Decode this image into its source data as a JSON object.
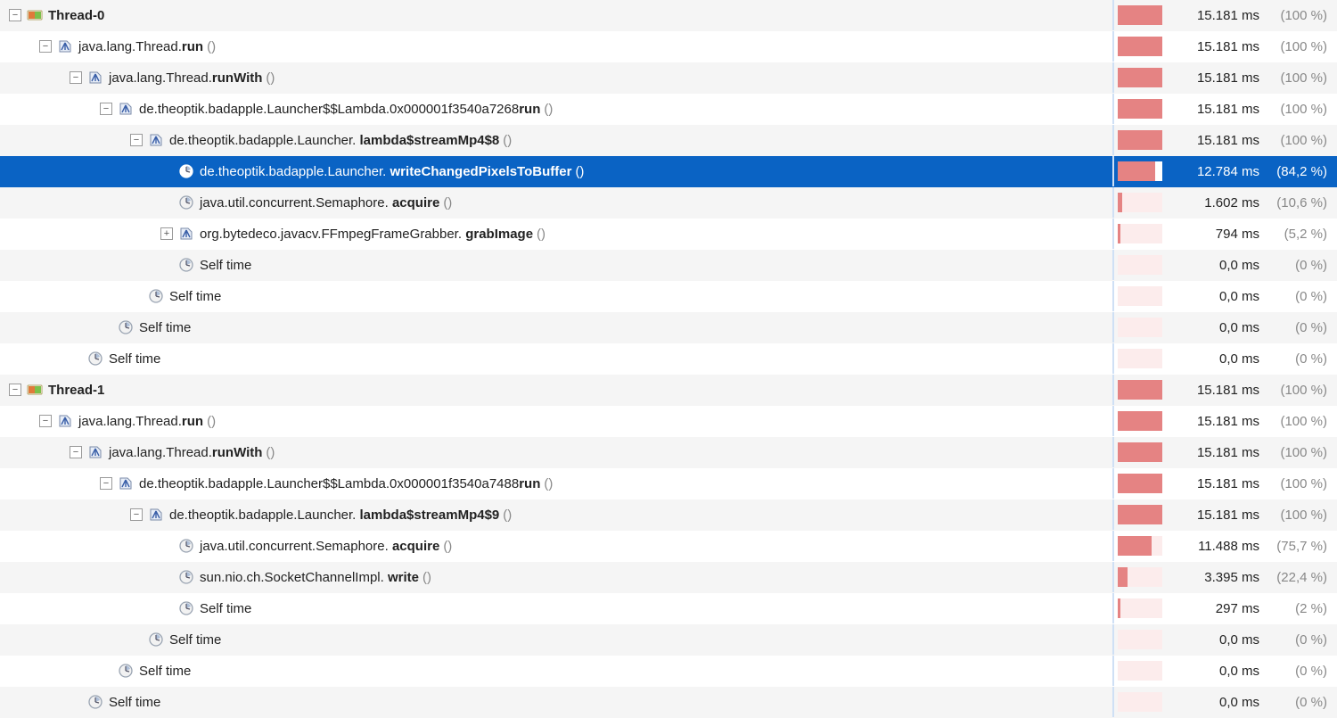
{
  "maxTime": 15.181,
  "rows": [
    {
      "depth": 0,
      "toggle": "minus",
      "icon": "thread",
      "pre": "",
      "bold": "Thread-0",
      "post": "",
      "paren": "",
      "time": 15.181,
      "timeLabel": "15.181 ms",
      "pct": "(100 %)",
      "alt": true,
      "selected": false
    },
    {
      "depth": 1,
      "toggle": "minus",
      "icon": "method",
      "pre": "java.lang.Thread.",
      "bold": "run",
      "post": "",
      "paren": "()",
      "time": 15.181,
      "timeLabel": "15.181 ms",
      "pct": "(100 %)",
      "alt": false,
      "selected": false
    },
    {
      "depth": 2,
      "toggle": "minus",
      "icon": "method",
      "pre": "java.lang.Thread.",
      "bold": "runWith",
      "post": "",
      "paren": "()",
      "time": 15.181,
      "timeLabel": "15.181 ms",
      "pct": "(100 %)",
      "alt": true,
      "selected": false
    },
    {
      "depth": 3,
      "toggle": "minus",
      "icon": "method",
      "pre": "de.theoptik.badapple.Launcher$$Lambda.0x000001f3540a7268",
      "bold": "run",
      "post": "",
      "paren": "()",
      "time": 15.181,
      "timeLabel": "15.181 ms",
      "pct": "(100 %)",
      "alt": false,
      "selected": false
    },
    {
      "depth": 4,
      "toggle": "minus",
      "icon": "method",
      "pre": "de.theoptik.badapple.Launcher. ",
      "bold": "lambda$streamMp4$8",
      "post": "",
      "paren": "()",
      "time": 15.181,
      "timeLabel": "15.181 ms",
      "pct": "(100 %)",
      "alt": true,
      "selected": false
    },
    {
      "depth": 5,
      "toggle": "leaf",
      "icon": "clock",
      "pre": "de.theoptik.badapple.Launcher. ",
      "bold": "writeChangedPixelsToBuffer",
      "post": "",
      "paren": "()",
      "time": 12.784,
      "timeLabel": "12.784 ms",
      "pct": "(84,2 %)",
      "alt": false,
      "selected": true
    },
    {
      "depth": 5,
      "toggle": "leaf",
      "icon": "clock",
      "pre": "java.util.concurrent.Semaphore. ",
      "bold": "acquire",
      "post": "",
      "paren": "()",
      "time": 1.602,
      "timeLabel": "1.602 ms",
      "pct": "(10,6 %)",
      "alt": true,
      "selected": false
    },
    {
      "depth": 5,
      "toggle": "plus",
      "icon": "method",
      "pre": "org.bytedeco.javacv.FFmpegFrameGrabber. ",
      "bold": "grabImage",
      "post": "",
      "paren": "()",
      "time": 0.794,
      "timeLabel": "794 ms",
      "pct": "(5,2 %)",
      "alt": false,
      "selected": false
    },
    {
      "depth": 5,
      "toggle": "leaf",
      "icon": "clock",
      "pre": "Self time",
      "bold": "",
      "post": "",
      "paren": "",
      "time": 0,
      "timeLabel": "0,0 ms",
      "pct": "(0 %)",
      "alt": true,
      "selected": false
    },
    {
      "depth": 4,
      "toggle": "leaf",
      "icon": "clock",
      "pre": "Self time",
      "bold": "",
      "post": "",
      "paren": "",
      "time": 0,
      "timeLabel": "0,0 ms",
      "pct": "(0 %)",
      "alt": false,
      "selected": false
    },
    {
      "depth": 3,
      "toggle": "leaf",
      "icon": "clock",
      "pre": "Self time",
      "bold": "",
      "post": "",
      "paren": "",
      "time": 0,
      "timeLabel": "0,0 ms",
      "pct": "(0 %)",
      "alt": true,
      "selected": false
    },
    {
      "depth": 2,
      "toggle": "leaf",
      "icon": "clock",
      "pre": "Self time",
      "bold": "",
      "post": "",
      "paren": "",
      "time": 0,
      "timeLabel": "0,0 ms",
      "pct": "(0 %)",
      "alt": false,
      "selected": false
    },
    {
      "depth": 0,
      "toggle": "minus",
      "icon": "thread",
      "pre": "",
      "bold": "Thread-1",
      "post": "",
      "paren": "",
      "time": 15.181,
      "timeLabel": "15.181 ms",
      "pct": "(100 %)",
      "alt": true,
      "selected": false
    },
    {
      "depth": 1,
      "toggle": "minus",
      "icon": "method",
      "pre": "java.lang.Thread.",
      "bold": "run",
      "post": "",
      "paren": "()",
      "time": 15.181,
      "timeLabel": "15.181 ms",
      "pct": "(100 %)",
      "alt": false,
      "selected": false
    },
    {
      "depth": 2,
      "toggle": "minus",
      "icon": "method",
      "pre": "java.lang.Thread.",
      "bold": "runWith",
      "post": "",
      "paren": "()",
      "time": 15.181,
      "timeLabel": "15.181 ms",
      "pct": "(100 %)",
      "alt": true,
      "selected": false
    },
    {
      "depth": 3,
      "toggle": "minus",
      "icon": "method",
      "pre": "de.theoptik.badapple.Launcher$$Lambda.0x000001f3540a7488",
      "bold": "run",
      "post": "",
      "paren": "()",
      "time": 15.181,
      "timeLabel": "15.181 ms",
      "pct": "(100 %)",
      "alt": false,
      "selected": false
    },
    {
      "depth": 4,
      "toggle": "minus",
      "icon": "method",
      "pre": "de.theoptik.badapple.Launcher. ",
      "bold": "lambda$streamMp4$9",
      "post": "",
      "paren": "()",
      "time": 15.181,
      "timeLabel": "15.181 ms",
      "pct": "(100 %)",
      "alt": true,
      "selected": false
    },
    {
      "depth": 5,
      "toggle": "leaf",
      "icon": "clock",
      "pre": "java.util.concurrent.Semaphore. ",
      "bold": "acquire",
      "post": "",
      "paren": "()",
      "time": 11.488,
      "timeLabel": "11.488 ms",
      "pct": "(75,7 %)",
      "alt": false,
      "selected": false
    },
    {
      "depth": 5,
      "toggle": "leaf",
      "icon": "clock",
      "pre": "sun.nio.ch.SocketChannelImpl. ",
      "bold": "write",
      "post": "",
      "paren": "()",
      "time": 3.395,
      "timeLabel": "3.395 ms",
      "pct": "(22,4 %)",
      "alt": true,
      "selected": false
    },
    {
      "depth": 5,
      "toggle": "leaf",
      "icon": "clock",
      "pre": "Self time",
      "bold": "",
      "post": "",
      "paren": "",
      "time": 0.297,
      "timeLabel": "297 ms",
      "pct": "(2 %)",
      "alt": false,
      "selected": false
    },
    {
      "depth": 4,
      "toggle": "leaf",
      "icon": "clock",
      "pre": "Self time",
      "bold": "",
      "post": "",
      "paren": "",
      "time": 0,
      "timeLabel": "0,0 ms",
      "pct": "(0 %)",
      "alt": true,
      "selected": false
    },
    {
      "depth": 3,
      "toggle": "leaf",
      "icon": "clock",
      "pre": "Self time",
      "bold": "",
      "post": "",
      "paren": "",
      "time": 0,
      "timeLabel": "0,0 ms",
      "pct": "(0 %)",
      "alt": false,
      "selected": false
    },
    {
      "depth": 2,
      "toggle": "leaf",
      "icon": "clock",
      "pre": "Self time",
      "bold": "",
      "post": "",
      "paren": "",
      "time": 0,
      "timeLabel": "0,0 ms",
      "pct": "(0 %)",
      "alt": true,
      "selected": false
    }
  ]
}
